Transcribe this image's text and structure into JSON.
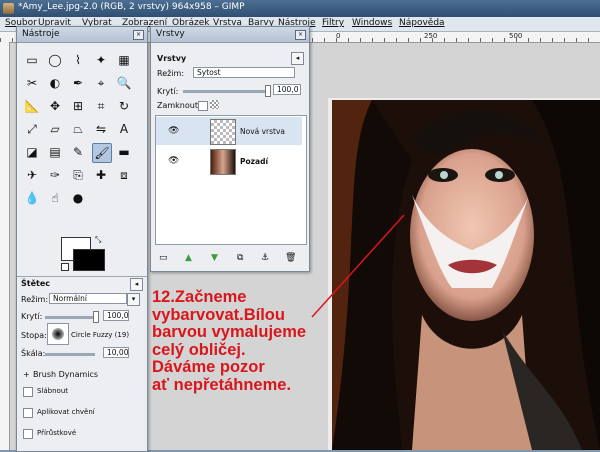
{
  "window": {
    "title": "*Amy_Lee.jpg-2.0 (RGB, 2 vrstvy) 964x958 – GIMP"
  },
  "menu": [
    "Soubor",
    "Upravit",
    "Vybrat",
    "Zobrazení",
    "Obrázek",
    "Vrstva",
    "Barvy",
    "Nástroje",
    "Filtry",
    "Windows",
    "Nápověda"
  ],
  "ruler": {
    "marks": [
      "0",
      "250",
      "500"
    ]
  },
  "toolbox": {
    "title": "Nástroje",
    "icons": [
      "rect-select-icon",
      "ellipse-select-icon",
      "free-select-icon",
      "fuzzy-select-icon",
      "color-select-icon",
      "scissors-icon",
      "foreground-select-icon",
      "paths-icon",
      "color-picker-icon",
      "zoom-icon",
      "measure-icon",
      "move-icon",
      "align-icon",
      "crop-icon",
      "rotate-icon",
      "scale-icon",
      "shear-icon",
      "perspective-icon",
      "flip-icon",
      "text-icon",
      "bucket-fill-icon",
      "blend-icon",
      "pencil-icon",
      "paintbrush-icon",
      "eraser-icon",
      "airbrush-icon",
      "ink-icon",
      "clone-icon",
      "heal-icon",
      "perspective-clone-icon",
      "blur-icon",
      "smudge-icon",
      "dodge-burn-icon"
    ],
    "brush_options": {
      "title": "Štětec",
      "mode_label": "Režim:",
      "mode_value": "Normální",
      "opacity_label": "Krytí:",
      "opacity_value": "100,0",
      "brush_label": "Stopa:",
      "brush_value": "Circle Fuzzy (19)",
      "scale_label": "Škála:",
      "scale_value": "10,00",
      "dynamics_label": "Brush Dynamics",
      "checks": [
        "Slábnout",
        "Aplikovat chvění",
        "Přírůstkové"
      ]
    }
  },
  "layers": {
    "window_title": "Vrstvy",
    "tab_title": "Vrstvy",
    "mode_label": "Režim:",
    "mode_value": "Sytost",
    "opacity_label": "Krytí:",
    "opacity_value": "100,0",
    "lock_label": "Zamknout:",
    "items": [
      {
        "name": "Nová vrstva",
        "selected": true
      },
      {
        "name": "Pozadí",
        "selected": false
      }
    ]
  },
  "annotation": {
    "lines": [
      "12.Začneme",
      "vybarvovat.Bílou",
      "barvou vymalujeme",
      "celý obličej.",
      "Dáváme pozor",
      "ať nepřetáhneme."
    ],
    "color": "#d8171c"
  }
}
